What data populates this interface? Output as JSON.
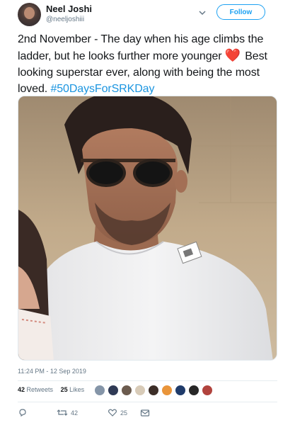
{
  "user": {
    "display_name": "Neel Joshi",
    "handle": "@neeljoshiii"
  },
  "header": {
    "follow_label": "Follow",
    "menu_icon": "chevron-down-icon"
  },
  "tweet": {
    "text_before": "2nd November - The day when his age climbs the ladder, but he looks further more younger ",
    "heart_emoji": "❤️",
    "text_after": " Best looking superstar ever, along with being the most loved. ",
    "hashtag": "#50DaysForSRKDay",
    "timestamp": "11:24 PM - 12 Sep 2019"
  },
  "stats": {
    "retweets_count": "42",
    "retweets_label": "Retweets",
    "likes_count": "25",
    "likes_label": "Likes"
  },
  "actions": {
    "reply_count": "",
    "retweet_count": "42",
    "like_count": "25"
  },
  "colors": {
    "link": "#1b95e0",
    "follow": "#1da1f2",
    "heart": "#e0245e",
    "muted": "#657786"
  }
}
